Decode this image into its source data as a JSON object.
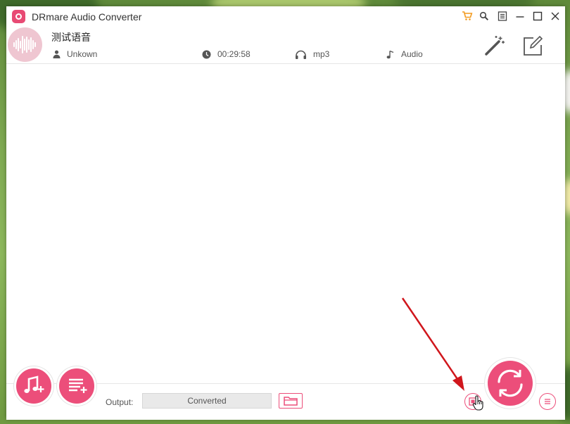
{
  "window": {
    "title": "DRmare Audio Converter"
  },
  "titlebar": {
    "icons": [
      "cart-icon",
      "search-icon",
      "menu-icon",
      "minimize-icon",
      "maximize-icon",
      "close-icon"
    ]
  },
  "file": {
    "name": "测试语音",
    "artist": "Unkown",
    "duration": "00:29:58",
    "format": "mp3",
    "genre": "Audio"
  },
  "bottom": {
    "output_label": "Output:",
    "output_value": "Converted"
  },
  "colors": {
    "accent": "#ec4e7a",
    "accent_light": "#efc6d1",
    "annotation_arrow": "#d0161c"
  }
}
